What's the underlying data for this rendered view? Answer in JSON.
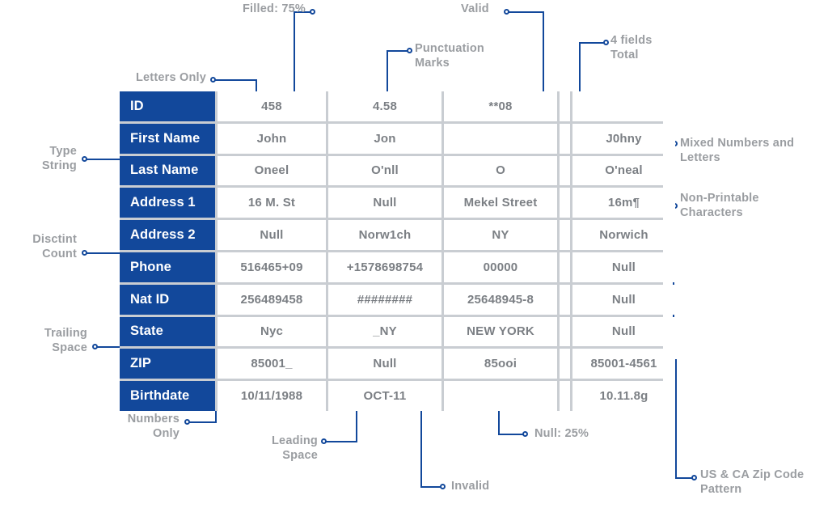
{
  "theme": {
    "header_blue": "#12489b",
    "connector_blue": "#12489b",
    "cell_text": "#7b7f84",
    "annotation_text": "#9a9da1",
    "grid_line": "#c9cdd2",
    "background": "#ffffff"
  },
  "table": {
    "row_headers": [
      "ID",
      "First Name",
      "Last Name",
      "Address 1",
      "Address 2",
      "Phone",
      "Nat ID",
      "State",
      "ZIP",
      "Birthdate"
    ],
    "rows": [
      {
        "header": "ID",
        "c1": "458",
        "c2": "4.58",
        "c3": "**08",
        "c4": "",
        "c5": ""
      },
      {
        "header": "First Name",
        "c1": "John",
        "c2": "Jon",
        "c3": "",
        "c4": "",
        "c5": "J0hny"
      },
      {
        "header": "Last Name",
        "c1": "Oneel",
        "c2": "O'nll",
        "c3": "O",
        "c4": "",
        "c5": "O'neal"
      },
      {
        "header": "Address 1",
        "c1": "16 M. St",
        "c2": "Null",
        "c3": "Mekel Street",
        "c4": "",
        "c5": "16m¶"
      },
      {
        "header": "Address 2",
        "c1": "Null",
        "c2": "Norw1ch",
        "c3": "NY",
        "c4": "",
        "c5": "Norwich"
      },
      {
        "header": "Phone",
        "c1": "516465+09",
        "c2": "+1578698754",
        "c3": "00000",
        "c4": "",
        "c5": "Null"
      },
      {
        "header": "Nat ID",
        "c1": "256489458",
        "c2": "########",
        "c3": "25648945-8",
        "c4": "",
        "c5": "Null"
      },
      {
        "header": "State",
        "c1": "Nyc",
        "c2": "_NY",
        "c3": "NEW YORK",
        "c4": "",
        "c5": "Null"
      },
      {
        "header": "ZIP",
        "c1": "85001_",
        "c2": "Null",
        "c3": "85ooi",
        "c4": "",
        "c5": "85001-4561"
      },
      {
        "header": "Birthdate",
        "c1": "10/11/1988",
        "c2": "OCT-11",
        "c3": "",
        "c4": "",
        "c5": "10.11.8g"
      }
    ]
  },
  "annotations": {
    "filled_percent": "Filled: 75%",
    "valid": "Valid",
    "fields_total": "4 fields\nTotal",
    "punctuation_marks": "Punctuation\nMarks",
    "letters_only": "Letters Only",
    "type_string": "Type\nString",
    "disctint_count": "Disctint\nCount",
    "trailing_space": "Trailing\nSpace",
    "numbers_only": "Numbers\nOnly",
    "mixed_numbers_and_letters": "Mixed Numbers and\nLetters",
    "non_printable_characters": "Non-Printable\nCharacters",
    "leading_space": "Leading\nSpace",
    "null_percent": "Null: 25%",
    "invalid": "Invalid",
    "zip_code_pattern": "US & CA Zip Code\nPattern"
  }
}
